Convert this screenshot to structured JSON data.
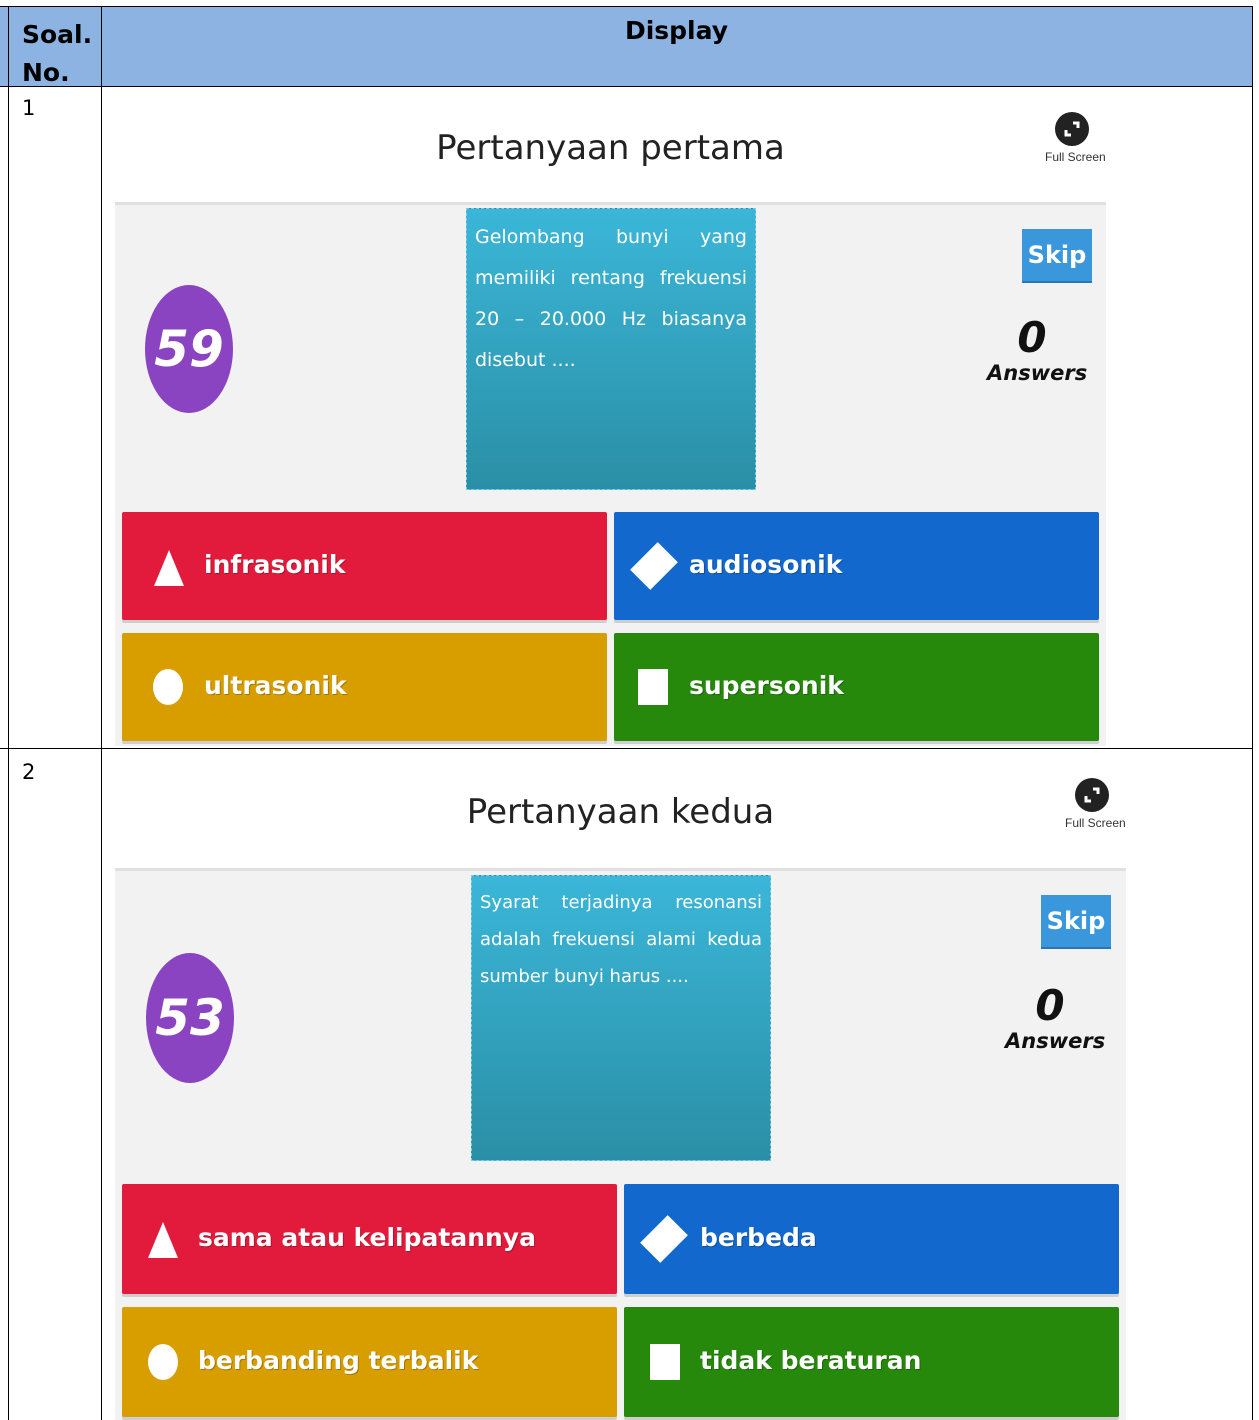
{
  "table": {
    "header_no": "Soal. No.",
    "header_no_line1": "Soal.",
    "header_no_line2": "No.",
    "header_display": "Display"
  },
  "rows": [
    {
      "number": "1",
      "title": "Pertanyaan pertama",
      "fullscreen_label": "Full Screen",
      "timer": "59",
      "question": "Gelombang bunyi yang memiliki rentang frekuensi 20 – 20.000 Hz biasanya disebut ....",
      "skip": "Skip",
      "answers_count": "0",
      "answers_label": "Answers",
      "options": [
        {
          "shape": "triangle-icon",
          "color": "#e21b3c",
          "text": "infrasonik"
        },
        {
          "shape": "diamond-icon",
          "color": "#1368ce",
          "text": "audiosonik"
        },
        {
          "shape": "circle-icon",
          "color": "#d89e00",
          "text": "ultrasonik"
        },
        {
          "shape": "square-icon",
          "color": "#26890c",
          "text": "supersonik"
        }
      ]
    },
    {
      "number": "2",
      "title": "Pertanyaan kedua",
      "fullscreen_label": "Full Screen",
      "timer": "53",
      "question": "Syarat terjadinya resonansi adalah frekuensi alami kedua sumber bunyi harus ....",
      "skip": "Skip",
      "answers_count": "0",
      "answers_label": "Answers",
      "options": [
        {
          "shape": "triangle-icon",
          "color": "#e21b3c",
          "text": "sama atau kelipatannya"
        },
        {
          "shape": "diamond-icon",
          "color": "#1368ce",
          "text": "berbeda"
        },
        {
          "shape": "circle-icon",
          "color": "#d89e00",
          "text": "berbanding terbalik"
        },
        {
          "shape": "square-icon",
          "color": "#26890c",
          "text": "tidak beraturan"
        }
      ]
    }
  ],
  "colors": {
    "header_bg": "#8db3e2",
    "timer_bg": "#8a44c2",
    "skip_bg": "#3b97dc",
    "question_bg": "#2fa3c2"
  }
}
